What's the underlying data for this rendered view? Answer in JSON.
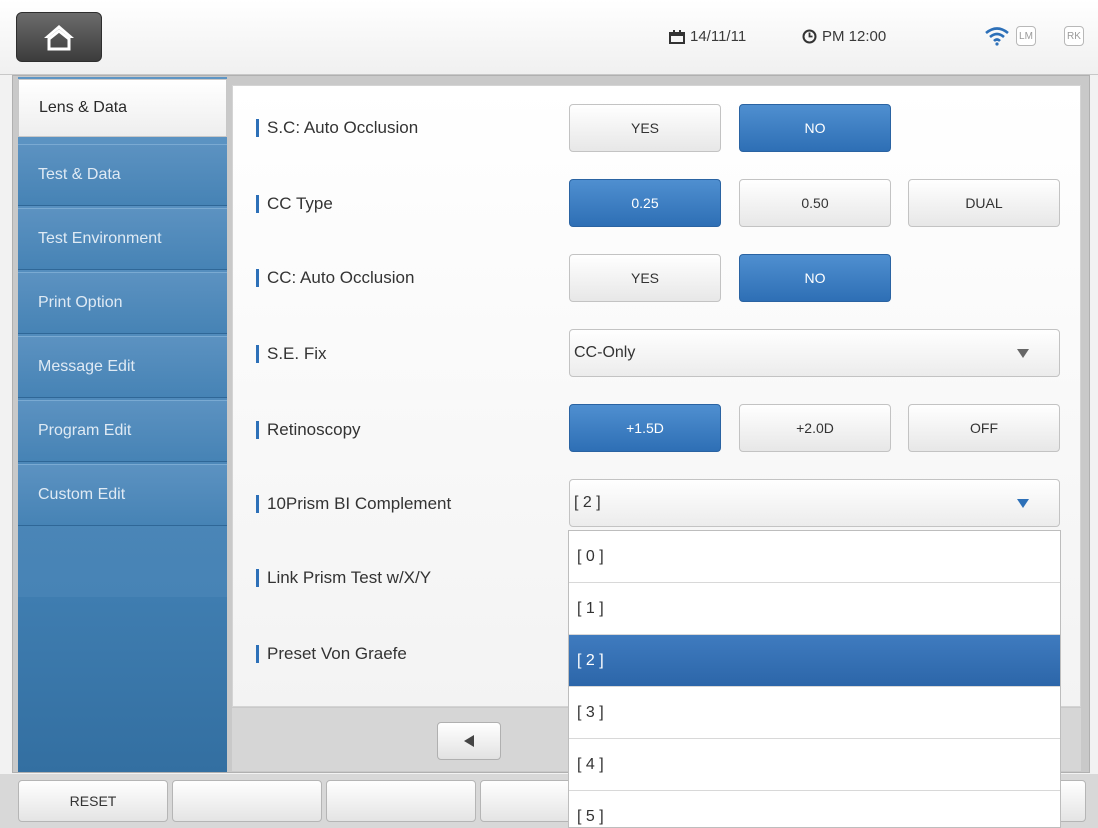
{
  "status": {
    "date": "14/11/11",
    "time": "PM 12:00",
    "badge_lm": "LM",
    "badge_rk": "RK",
    "icons": [
      "home-icon",
      "calendar-icon",
      "clock-icon",
      "wifi-icon"
    ]
  },
  "sidebar": {
    "items": [
      {
        "label": "Lens & Data",
        "active": true
      },
      {
        "label": "Test & Data"
      },
      {
        "label": "Test Environment"
      },
      {
        "label": "Print Option"
      },
      {
        "label": "Message Edit"
      },
      {
        "label": "Program Edit"
      },
      {
        "label": "Custom Edit"
      }
    ]
  },
  "settings": {
    "sc_auto_occlusion": {
      "label": "S.C: Auto Occlusion",
      "options": [
        "YES",
        "NO"
      ],
      "selected": "NO"
    },
    "cc_type": {
      "label": "CC Type",
      "options": [
        "0.25",
        "0.50",
        "DUAL"
      ],
      "selected": "0.25"
    },
    "cc_auto_occlusion": {
      "label": "CC: Auto Occlusion",
      "options": [
        "YES",
        "NO"
      ],
      "selected": "NO"
    },
    "se_fix": {
      "label": "S.E. Fix",
      "value": "CC-Only"
    },
    "retinoscopy": {
      "label": "Retinoscopy",
      "options": [
        "+1.5D",
        "+2.0D",
        "OFF"
      ],
      "selected": "+1.5D"
    },
    "prism_bi": {
      "label": "10Prism BI Complement",
      "value": "[ 2 ]"
    },
    "link_prism": {
      "label": "Link Prism Test w/X/Y"
    },
    "von_graefe": {
      "label": "Preset Von Graefe"
    }
  },
  "dropdown": {
    "options": [
      "[ 0 ]",
      "[ 1 ]",
      "[ 2 ]",
      "[ 3 ]",
      "[ 4 ]",
      "[ 5 ]"
    ],
    "selected": "[ 2 ]"
  },
  "bottom": {
    "reset_label": "RESET"
  },
  "colors": {
    "accent": "#2e6fb5",
    "sidebar": "#4a86b8"
  }
}
